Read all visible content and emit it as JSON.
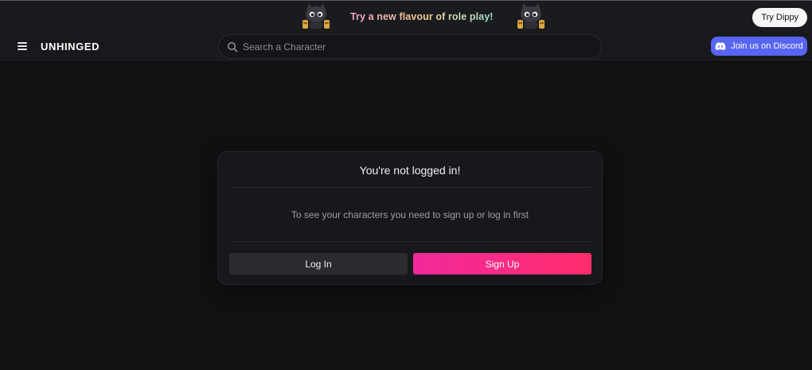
{
  "promo": {
    "text": "Try a new flavour of role play!",
    "cta_label": "Try Dippy"
  },
  "header": {
    "logo": "UNHINGED",
    "search_placeholder": "Search a Character",
    "discord_label": "Join us on Discord"
  },
  "card": {
    "title": "You're not logged in!",
    "message": "To see your characters you need to sign up or log in first",
    "login_label": "Log In",
    "signup_label": "Sign Up"
  },
  "colors": {
    "background": "#111113",
    "discord": "#5865f2",
    "signup_start": "#f2299c",
    "signup_end": "#ff2d6d"
  },
  "icons": [
    "menu-icon",
    "search-icon",
    "discord-icon",
    "cat-mascot-icon"
  ]
}
